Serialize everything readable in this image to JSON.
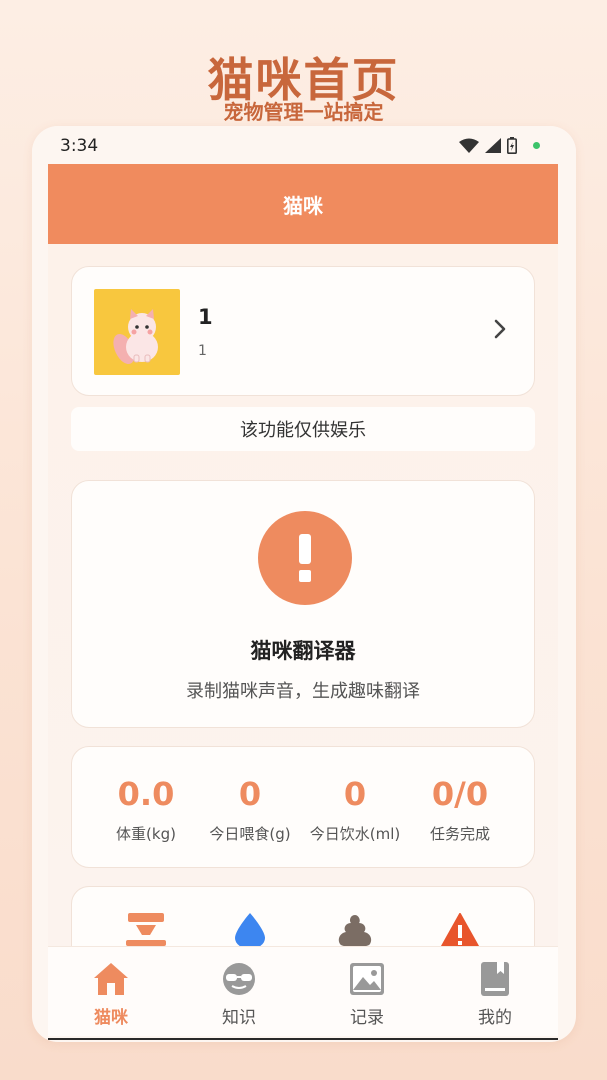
{
  "promo": {
    "title": "猫咪首页",
    "subtitle": "宠物管理一站搞定"
  },
  "status": {
    "time": "3:34"
  },
  "appbar": {
    "title": "猫咪"
  },
  "pet": {
    "name": "1",
    "sub": "1"
  },
  "notice": "该功能仅供娱乐",
  "translator": {
    "title": "猫咪翻译器",
    "desc": "录制猫咪声音，生成趣味翻译"
  },
  "stats": [
    {
      "value": "0.0",
      "label": "体重(kg)"
    },
    {
      "value": "0",
      "label": "今日喂食(g)"
    },
    {
      "value": "0",
      "label": "今日饮水(ml)"
    },
    {
      "value": "0/0",
      "label": "任务完成"
    }
  ],
  "quick_icons": [
    "feeder-icon",
    "water-drop-icon",
    "poop-icon",
    "warning-icon"
  ],
  "tabs": [
    {
      "label": "猫咪",
      "icon": "home-icon",
      "active": true
    },
    {
      "label": "知识",
      "icon": "glasses-icon",
      "active": false
    },
    {
      "label": "记录",
      "icon": "image-icon",
      "active": false
    },
    {
      "label": "我的",
      "icon": "book-icon",
      "active": false
    }
  ],
  "colors": {
    "accent": "#ee8b5f",
    "appbar": "#f08b5e",
    "promo": "#c8673c"
  }
}
